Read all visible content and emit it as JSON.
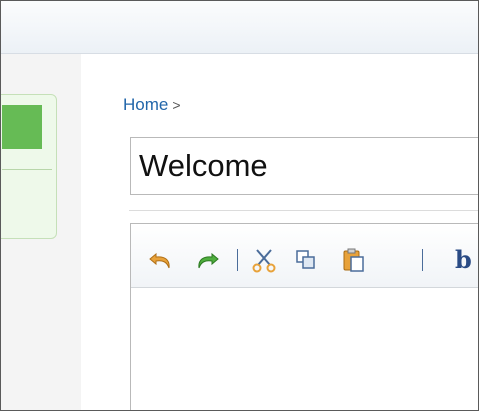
{
  "breadcrumb": {
    "home": "Home",
    "separator": ">"
  },
  "page": {
    "title_value": "Welcome"
  },
  "toolbar": {
    "undo_icon": "undo-arrow",
    "redo_icon": "redo-arrow",
    "cut_icon": "scissors",
    "copy_icon": "copy",
    "paste_icon": "paste-clipboard",
    "bold_label": "b"
  },
  "colors": {
    "link": "#2266aa",
    "sidebar_active": "#66bb55",
    "sidebar_panel": "#eef9ea",
    "undo": "#e8a23a",
    "redo": "#4fae3e",
    "toolbar_icon": "#2a4b85"
  }
}
